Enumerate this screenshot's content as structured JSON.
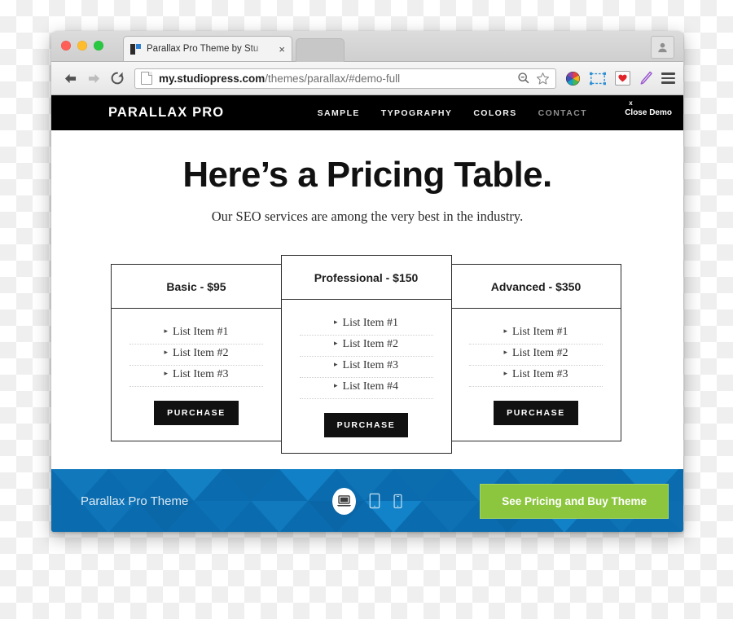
{
  "browser": {
    "tab": {
      "title": "Parallax Pro Theme by Stu",
      "close_label": "×",
      "favicon_name": "studiopress-favicon"
    },
    "traffic_lights": [
      "close",
      "minimize",
      "maximize"
    ],
    "toolbar": {
      "back_label": "Back",
      "forward_label": "Forward",
      "reload_label": "Reload",
      "url_host": "my.studiopress.com",
      "url_path": "/themes/parallax/#demo-full",
      "zoom_icon": "search-minus-icon",
      "bookmark_icon": "star-icon",
      "extensions": [
        "color-wheel-icon",
        "screenshot-frame-icon",
        "heart-icon",
        "pen-icon"
      ],
      "menu_icon": "hamburger-menu-icon"
    },
    "profile_icon": "user-avatar-icon"
  },
  "site": {
    "logo": "PARALLAX PRO",
    "nav": [
      {
        "label": "SAMPLE",
        "dim": false
      },
      {
        "label": "TYPOGRAPHY",
        "dim": false
      },
      {
        "label": "COLORS",
        "dim": false
      },
      {
        "label": "CONTACT",
        "dim": true
      }
    ],
    "demo_close": {
      "x": "x",
      "label": "Close Demo"
    }
  },
  "hero": {
    "title": "Here’s a Pricing Table.",
    "subtitle": "Our SEO services are among the very best in the industry."
  },
  "pricing": {
    "bullet": "▸",
    "plans": [
      {
        "name": "Basic - $95",
        "featured": false,
        "features": [
          "List Item #1",
          "List Item #2",
          "List Item #3"
        ],
        "button": "PURCHASE"
      },
      {
        "name": "Professional - $150",
        "featured": true,
        "features": [
          "List Item #1",
          "List Item #2",
          "List Item #3",
          "List Item #4"
        ],
        "button": "PURCHASE"
      },
      {
        "name": "Advanced - $350",
        "featured": false,
        "features": [
          "List Item #1",
          "List Item #2",
          "List Item #3"
        ],
        "button": "PURCHASE"
      }
    ]
  },
  "demo_bar": {
    "theme_name": "Parallax Pro Theme",
    "devices": [
      {
        "icon": "laptop-icon",
        "active": true
      },
      {
        "icon": "tablet-icon",
        "active": false
      },
      {
        "icon": "phone-icon",
        "active": false
      }
    ],
    "cta": "See Pricing and Buy Theme"
  },
  "colors": {
    "nav_bg": "#000000",
    "demo_bar_bg": "#0a6cae",
    "cta_green": "#8cc63e",
    "button_black": "#111111"
  }
}
